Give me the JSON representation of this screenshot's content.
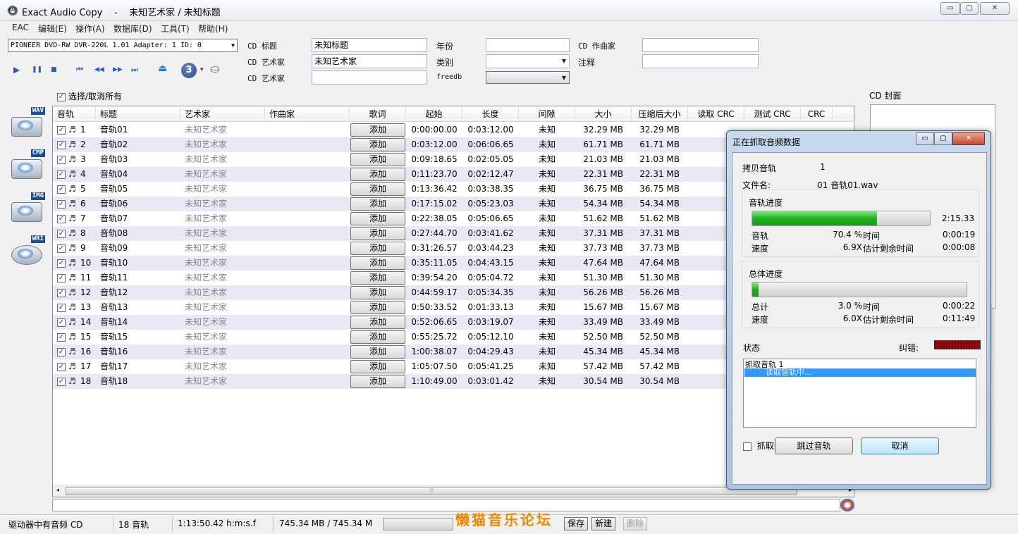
{
  "window": {
    "title_app": "Exact Audio Copy",
    "title_sep": "-",
    "title_doc": "未知艺术家 / 未知标题",
    "app_icon": "EAC"
  },
  "window_controls": {
    "minimize": "▭",
    "restore": "▢",
    "close": "✕"
  },
  "menu": [
    "EAC",
    "编辑(E)",
    "操作(A)",
    "数据库(D)",
    "工具(T)",
    "帮助(H)"
  ],
  "drive": {
    "value": "PIONEER DVD-RW  DVR-220L 1.01  Adapter: 1  ID: 0"
  },
  "playback_icons": [
    "play-icon",
    "pause-icon",
    "stop-icon",
    "first-track-icon",
    "previous-icon",
    "next-icon",
    "last-track-icon",
    "eject-icon",
    "speed-icon",
    "drive-options-icon"
  ],
  "playback_glyphs": [
    "▶",
    "❚❚",
    "■",
    "⏮",
    "◀◀",
    "▶▶",
    "⏭",
    "⏏",
    "3",
    "▾",
    "⛀"
  ],
  "cd_meta": {
    "title_label": "CD 标题",
    "title_value": "未知标题",
    "artist_label": "CD 艺术家",
    "artist_value": "未知艺术家",
    "artist2_label": "CD 艺术家",
    "artist2_value": "",
    "year_label": "年份",
    "year_value": "",
    "genre_label": "类别",
    "genre_value": "",
    "freedb_label": "freedb",
    "freedb_value": "",
    "composer_label": "CD 作曲家",
    "composer_value": "",
    "comment_label": "注释",
    "comment_value": ""
  },
  "select_all_label": "选择/取消所有",
  "cover_label": "CD 封面",
  "sidebar_tags": [
    "WAV",
    "CMP",
    "IMG",
    "WRI"
  ],
  "columns": [
    "音轨",
    "标题",
    "艺术家",
    "作曲家",
    "歌词",
    "起始",
    "长度",
    "间隙",
    "大小",
    "压缩后大小",
    "读取 CRC",
    "测试 CRC",
    "CRC"
  ],
  "add_label": "添加",
  "tracks": [
    {
      "num": "1",
      "title": "音轨01",
      "artist": "未知艺术家",
      "start": "0:00:00.00",
      "length": "0:03:12.00",
      "gap": "未知",
      "size": "32.29 MB",
      "csize": "32.29 MB"
    },
    {
      "num": "2",
      "title": "音轨02",
      "artist": "未知艺术家",
      "start": "0:03:12.00",
      "length": "0:06:06.65",
      "gap": "未知",
      "size": "61.71 MB",
      "csize": "61.71 MB"
    },
    {
      "num": "3",
      "title": "音轨03",
      "artist": "未知艺术家",
      "start": "0:09:18.65",
      "length": "0:02:05.05",
      "gap": "未知",
      "size": "21.03 MB",
      "csize": "21.03 MB"
    },
    {
      "num": "4",
      "title": "音轨04",
      "artist": "未知艺术家",
      "start": "0:11:23.70",
      "length": "0:02:12.47",
      "gap": "未知",
      "size": "22.31 MB",
      "csize": "22.31 MB"
    },
    {
      "num": "5",
      "title": "音轨05",
      "artist": "未知艺术家",
      "start": "0:13:36.42",
      "length": "0:03:38.35",
      "gap": "未知",
      "size": "36.75 MB",
      "csize": "36.75 MB"
    },
    {
      "num": "6",
      "title": "音轨06",
      "artist": "未知艺术家",
      "start": "0:17:15.02",
      "length": "0:05:23.03",
      "gap": "未知",
      "size": "54.34 MB",
      "csize": "54.34 MB"
    },
    {
      "num": "7",
      "title": "音轨07",
      "artist": "未知艺术家",
      "start": "0:22:38.05",
      "length": "0:05:06.65",
      "gap": "未知",
      "size": "51.62 MB",
      "csize": "51.62 MB"
    },
    {
      "num": "8",
      "title": "音轨08",
      "artist": "未知艺术家",
      "start": "0:27:44.70",
      "length": "0:03:41.62",
      "gap": "未知",
      "size": "37.31 MB",
      "csize": "37.31 MB"
    },
    {
      "num": "9",
      "title": "音轨09",
      "artist": "未知艺术家",
      "start": "0:31:26.57",
      "length": "0:03:44.23",
      "gap": "未知",
      "size": "37.73 MB",
      "csize": "37.73 MB"
    },
    {
      "num": "10",
      "title": "音轨10",
      "artist": "未知艺术家",
      "start": "0:35:11.05",
      "length": "0:04:43.15",
      "gap": "未知",
      "size": "47.64 MB",
      "csize": "47.64 MB"
    },
    {
      "num": "11",
      "title": "音轨11",
      "artist": "未知艺术家",
      "start": "0:39:54.20",
      "length": "0:05:04.72",
      "gap": "未知",
      "size": "51.30 MB",
      "csize": "51.30 MB"
    },
    {
      "num": "12",
      "title": "音轨12",
      "artist": "未知艺术家",
      "start": "0:44:59.17",
      "length": "0:05:34.35",
      "gap": "未知",
      "size": "56.26 MB",
      "csize": "56.26 MB"
    },
    {
      "num": "13",
      "title": "音轨13",
      "artist": "未知艺术家",
      "start": "0:50:33.52",
      "length": "0:01:33.13",
      "gap": "未知",
      "size": "15.67 MB",
      "csize": "15.67 MB"
    },
    {
      "num": "14",
      "title": "音轨14",
      "artist": "未知艺术家",
      "start": "0:52:06.65",
      "length": "0:03:19.07",
      "gap": "未知",
      "size": "33.49 MB",
      "csize": "33.49 MB"
    },
    {
      "num": "15",
      "title": "音轨15",
      "artist": "未知艺术家",
      "start": "0:55:25.72",
      "length": "0:05:12.10",
      "gap": "未知",
      "size": "52.50 MB",
      "csize": "52.50 MB"
    },
    {
      "num": "16",
      "title": "音轨16",
      "artist": "未知艺术家",
      "start": "1:00:38.07",
      "length": "0:04:29.43",
      "gap": "未知",
      "size": "45.34 MB",
      "csize": "45.34 MB"
    },
    {
      "num": "17",
      "title": "音轨17",
      "artist": "未知艺术家",
      "start": "1:05:07.50",
      "length": "0:05:41.25",
      "gap": "未知",
      "size": "57.42 MB",
      "csize": "57.42 MB"
    },
    {
      "num": "18",
      "title": "音轨18",
      "artist": "未知艺术家",
      "start": "1:10:49.00",
      "length": "0:03:01.42",
      "gap": "未知",
      "size": "30.54 MB",
      "csize": "30.54 MB"
    }
  ],
  "statusbar": {
    "drive_status": "驱动器中有音频 CD",
    "track_count": "18 音轨",
    "total_time": "1:13:50.42 h:m:s.f",
    "total_size": "745.34 MB / 745.34 M",
    "save": "保存",
    "new": "新建",
    "delete": "删除"
  },
  "watermark": "懒猫音乐论坛",
  "dialog": {
    "title": "正在抓取音频数据",
    "copy_track_label": "拷贝音轨",
    "copy_track_value": "1",
    "filename_label": "文件名:",
    "filename_value": "01 音轨01.wav",
    "track_progress_label": "音轨进度",
    "track_progress": 0.704,
    "track_progress_time": "2:15.33",
    "track_label": "音轨",
    "track_percent": "70.4 %",
    "track_time_label": "时间",
    "track_time": "0:00:19",
    "track_speed_label": "速度",
    "track_speed": "6.9X",
    "track_remaining_label": "估计剩余时间",
    "track_remaining": "0:00:08",
    "total_progress_label": "总体进度",
    "total_progress": 0.03,
    "total_label": "总计",
    "total_percent": "3.0 %",
    "total_time_label": "时间",
    "total_time": "0:00:22",
    "total_speed_label": "速度",
    "total_speed": "6.0X",
    "total_remaining_label": "估计剩余时间",
    "total_remaining": "0:11:49",
    "status_label": "状态",
    "error_label": "纠错:",
    "log_lines": [
      "抓取音轨  1",
      "读取音轨中..."
    ],
    "hibernate_label": "抓取完毕后休眠计算机",
    "skip_button": "跳过音轨",
    "cancel_button": "取消"
  }
}
